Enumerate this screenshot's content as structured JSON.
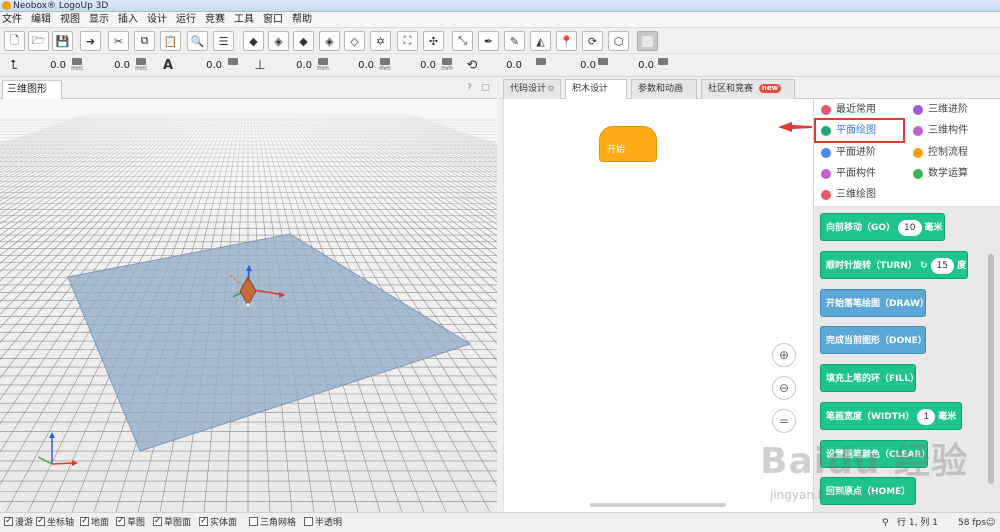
{
  "app": {
    "title": "Neobox® LogoUp 3D"
  },
  "menu": [
    "文件",
    "编辑",
    "视图",
    "显示",
    "插入",
    "设计",
    "运行",
    "竞赛",
    "工具",
    "窗口",
    "帮助"
  ],
  "toolbar": {
    "tools": [
      "new-file-icon",
      "open-file-icon",
      "save-icon",
      "import-icon",
      "cut-icon",
      "copy-icon",
      "paste-icon",
      "search-icon",
      "align-icon",
      "cube-icon",
      "cube-front-icon",
      "cube-top-icon",
      "cube-side-icon",
      "cube-iso-icon",
      "star-icon",
      "fit-view-icon",
      "axis-move-icon",
      "expand-icon",
      "pen-icon",
      "pen-edit-icon",
      "paint-bucket-icon",
      "pin-icon",
      "rotate-cube-icon",
      "cube-wire-icon",
      "disabled-icon"
    ]
  },
  "toolbar2": {
    "fields": [
      "0.0",
      "0.0",
      "0.0",
      "0.0",
      "0.0",
      "0.0",
      "0.0"
    ],
    "unit": "mm"
  },
  "left_panel": {
    "tab": "三维图形"
  },
  "right_tabs": [
    {
      "label": "代码设计"
    },
    {
      "label": "积木设计"
    },
    {
      "label": "参数和动画"
    },
    {
      "label": "社区和竞赛",
      "badge": "new"
    }
  ],
  "workspace": {
    "start_block": "开始"
  },
  "categories": [
    {
      "label": "最近常用",
      "color": "#e8566c"
    },
    {
      "label": "三维进阶",
      "color": "#9b59d6"
    },
    {
      "label": "平面绘图",
      "color": "#1fa37a"
    },
    {
      "label": "三维构件",
      "color": "#c45fd0"
    },
    {
      "label": "平面进阶",
      "color": "#4a88e8"
    },
    {
      "label": "控制流程",
      "color": "#f5a000"
    },
    {
      "label": "平面构件",
      "color": "#c45fd0"
    },
    {
      "label": "数学运算",
      "color": "#3cb551"
    },
    {
      "label": "三维绘图",
      "color": "#e8566c"
    }
  ],
  "blocks": [
    {
      "text": "向前移动（GO）",
      "value": "10",
      "suffix": "毫米"
    },
    {
      "text": "顺时针旋转（TURN）",
      "symbol": "↻",
      "value": "15",
      "suffix": "度"
    },
    {
      "text": "开始落笔绘图（DRAW）"
    },
    {
      "text": "完成当前图形（DONE）"
    },
    {
      "text": "填充上笔的环（FILL）"
    },
    {
      "text": "笔画宽度（WIDTH）",
      "value": "1",
      "suffix": "毫米"
    },
    {
      "text": "设置画笔颜色（CLEAR）"
    },
    {
      "text": "回到原点（HOME）"
    }
  ],
  "status": {
    "items": [
      {
        "label": "漫游",
        "checked": true
      },
      {
        "label": "坐标轴",
        "checked": true
      },
      {
        "label": "地面",
        "checked": true
      },
      {
        "label": "草图",
        "checked": true
      },
      {
        "label": "草图面",
        "checked": true
      },
      {
        "label": "实体面",
        "checked": true
      },
      {
        "label": "三角网格",
        "checked": false
      },
      {
        "label": "半透明",
        "checked": false
      }
    ],
    "position": "行 1, 列 1",
    "fps": "58 fps"
  },
  "watermark": {
    "main": "Baidu 经验",
    "sub": "jingyan.baidu.com"
  }
}
